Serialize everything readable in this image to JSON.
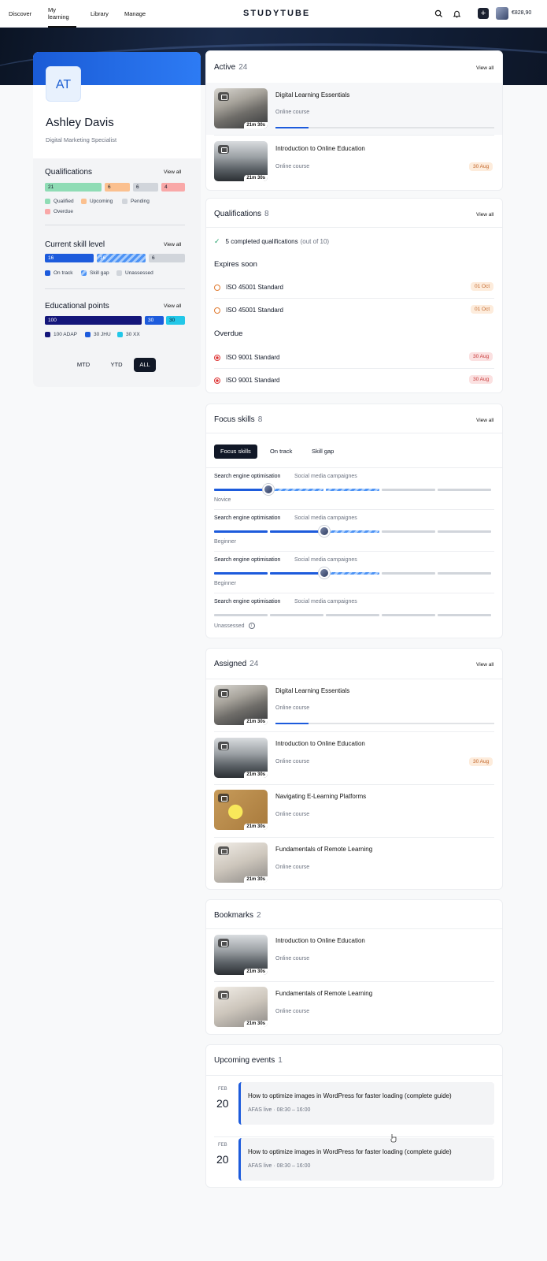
{
  "nav": {
    "discover": "Discover",
    "my_learning": "My learning",
    "library": "Library",
    "manage": "Manage",
    "logo": "STUDYTUBE",
    "wallet": "€828,90"
  },
  "profile": {
    "initials": "AT",
    "name": "Ashley Davis",
    "title": "Digital Marketing Specialist"
  },
  "qualifications_side": {
    "title": "Qualifications",
    "view_all": "View all",
    "bars": [
      "21",
      "6",
      "6",
      "4"
    ],
    "legend": [
      "Qualified",
      "Upcoming",
      "Pending",
      "Overdue"
    ]
  },
  "skill_side": {
    "title": "Current skill level",
    "view_all": "View all",
    "bars": [
      "16",
      "16",
      "6"
    ],
    "legend": [
      "On track",
      "Skill gap",
      "Unassessed"
    ]
  },
  "points_side": {
    "title": "Educational points",
    "view_all": "View all",
    "bars": [
      "100",
      "30",
      "30"
    ],
    "legend": [
      "100 ADAP",
      "30 JHU",
      "30 XX"
    ]
  },
  "periods": [
    "MTD",
    "YTD",
    "ALL"
  ],
  "colors": {
    "accent": "#1d5bdc",
    "navy": "#14167a",
    "qualified": "#8fdcb5",
    "upcoming": "#fbc08f",
    "pending": "#d1d5db",
    "overdue": "#f9a8a8",
    "cyan": "#22c7e8"
  },
  "active": {
    "title": "Active",
    "count": "24",
    "view_all": "View all",
    "items": [
      {
        "title": "Digital Learning Essentials",
        "sub": "Online course",
        "dur": "21m 30s",
        "progress": 0.15
      },
      {
        "title": "Introduction to Online Education",
        "sub": "Online course",
        "dur": "21m 30s",
        "tag": "30 Aug"
      }
    ]
  },
  "qualifications": {
    "title": "Qualifications",
    "count": "8",
    "view_all": "View all",
    "completed": "5 completed qualifications",
    "completed_note": "(out of 10)",
    "expires": "Expires soon",
    "overdue": "Overdue",
    "expiring": [
      {
        "name": "ISO 45001 Standard",
        "tag": "01 Oct"
      },
      {
        "name": "ISO 45001 Standard",
        "tag": "01 Oct"
      }
    ],
    "overdue_items": [
      {
        "name": "ISO 9001 Standard",
        "tag": "30 Aug"
      },
      {
        "name": "ISO 9001 Standard",
        "tag": "30 Aug"
      }
    ]
  },
  "focus": {
    "title": "Focus skills",
    "count": "8",
    "view_all": "View all",
    "tabs": [
      "Focus skills",
      "On track",
      "Skill gap"
    ],
    "rows": [
      {
        "skill": "Search engine optimisation",
        "secondary": "Social media campaignes",
        "level": "Novice",
        "current": 1,
        "target": 3
      },
      {
        "skill": "Search engine optimisation",
        "secondary": "Social media campaignes",
        "level": "Beginner",
        "current": 2,
        "target": 3
      },
      {
        "skill": "Search engine optimisation",
        "secondary": "Social media campaignes",
        "level": "Beginner",
        "current": 2,
        "target": 3
      },
      {
        "skill": "Search engine optimisation",
        "secondary": "Social media campaignes",
        "level": "Unassessed",
        "current": 0,
        "target": 0
      }
    ]
  },
  "assigned": {
    "title": "Assigned",
    "count": "24",
    "view_all": "View all",
    "items": [
      {
        "title": "Digital Learning Essentials",
        "sub": "Online course",
        "dur": "21m 30s",
        "progress": 0.15
      },
      {
        "title": "Introduction to Online Education",
        "sub": "Online course",
        "dur": "21m 30s",
        "tag": "30 Aug"
      },
      {
        "title": "Navigating E-Learning Platforms",
        "sub": "Online course",
        "dur": "21m 30s"
      },
      {
        "title": "Fundamentals of Remote Learning",
        "sub": "Online course",
        "dur": "21m 30s"
      }
    ]
  },
  "bookmarks": {
    "title": "Bookmarks",
    "count": "2",
    "items": [
      {
        "title": "Introduction to Online Education",
        "sub": "Online course",
        "dur": "21m 30s"
      },
      {
        "title": "Fundamentals of Remote Learning",
        "sub": "Online course",
        "dur": "21m 30s"
      }
    ]
  },
  "events": {
    "title": "Upcoming events",
    "count": "1",
    "items": [
      {
        "month": "FEB",
        "day": "20",
        "title": "How to optimize images in WordPress for faster loading (complete guide)",
        "meta": "AFAS live · 08:30 – 16:00"
      },
      {
        "month": "FEB",
        "day": "20",
        "title": "How to optimize images in WordPress for faster loading (complete guide)",
        "meta": "AFAS live · 08:30 – 16:00"
      }
    ]
  }
}
